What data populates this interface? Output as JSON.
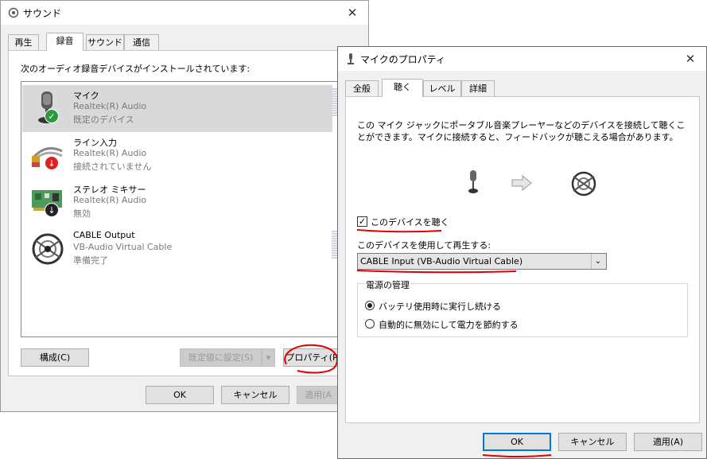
{
  "sound_window": {
    "title": "サウンド",
    "tabs": [
      "再生",
      "録音",
      "サウンド",
      "通信"
    ],
    "active_tab": "録音",
    "heading": "次のオーディオ録音デバイスがインストールされています:",
    "devices": [
      {
        "name": "マイク",
        "driver": "Realtek(R) Audio",
        "status": "既定のデバイス",
        "icon": "microphone-icon",
        "badge": "✓"
      },
      {
        "name": "ライン入力",
        "driver": "Realtek(R) Audio",
        "status": "接続されていません",
        "icon": "line-in-cable-icon",
        "badge": "↓"
      },
      {
        "name": "ステレオ ミキサー",
        "driver": "Realtek(R) Audio",
        "status": "無効",
        "icon": "sound-card-icon",
        "badge": "↓"
      },
      {
        "name": "CABLE Output",
        "driver": "VB-Audio Virtual Cable",
        "status": "準備完了",
        "icon": "virtual-cable-icon",
        "badge": ""
      }
    ],
    "buttons": {
      "configure": "構成(C)",
      "set_default": "既定値に設定(S)",
      "properties": "プロパティ(P",
      "ok": "OK",
      "cancel": "キャンセル",
      "apply": "適用(A"
    }
  },
  "props_window": {
    "title": "マイクのプロパティ",
    "tabs": [
      "全般",
      "聴く",
      "レベル",
      "詳細"
    ],
    "active_tab": "聴く",
    "description": "この マイク ジャックにポータブル音楽プレーヤーなどのデバイスを接続して聴くことができます。マイクに接続すると、フィードバックが聴こえる場合があります。",
    "listen_checkbox": {
      "label": "このデバイスを聴く",
      "checked": true
    },
    "playback_label": "このデバイスを使用して再生する:",
    "playback_device": "CABLE Input (VB-Audio Virtual Cable)",
    "power_group": {
      "title": "電源の管理",
      "options": [
        "バッテリ使用時に実行し続ける",
        "自動的に無効にして電力を節約する"
      ],
      "selected": 0
    },
    "buttons": {
      "ok": "OK",
      "cancel": "キャンセル",
      "apply": "適用(A)"
    }
  },
  "colors": {
    "accent": "#0078d7",
    "annotation": "#e00000",
    "check": "#2b9a3a",
    "arrow_badge": "#e02020"
  }
}
